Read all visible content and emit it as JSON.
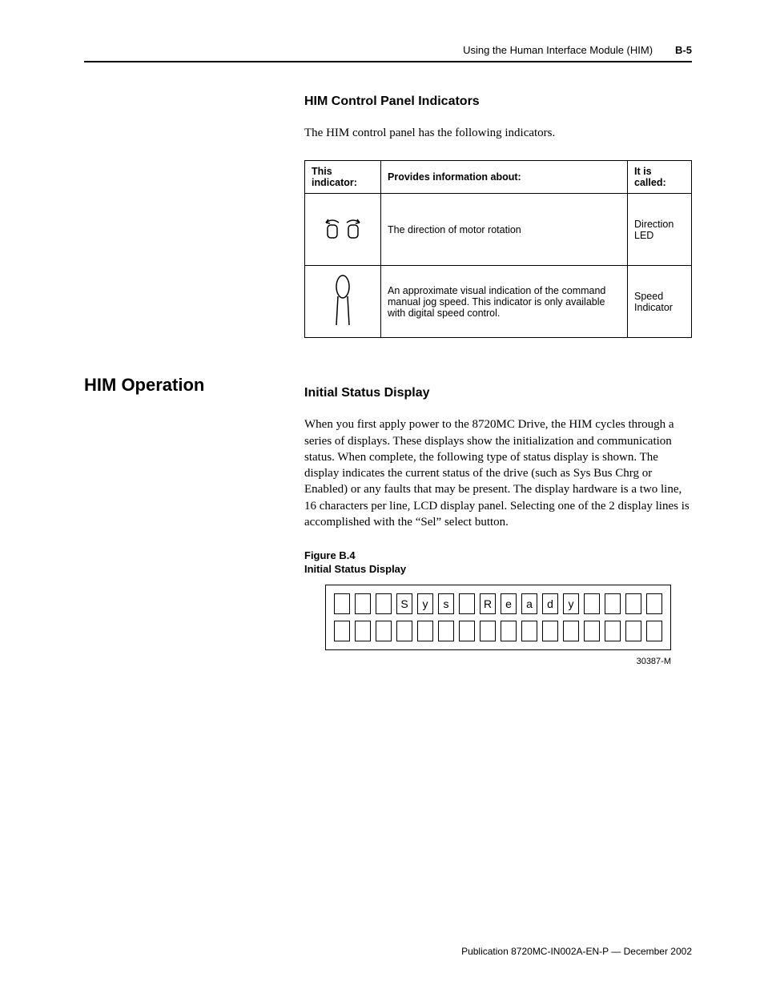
{
  "header": {
    "running_head": "Using the Human Interface Module (HIM)",
    "page_number": "B-5"
  },
  "section1": {
    "heading": "HIM Control Panel Indicators",
    "intro": "The HIM control panel has the following indicators.",
    "table": {
      "headers": [
        "This indicator:",
        "Provides information about:",
        "It is called:"
      ],
      "rows": [
        {
          "provides": "The direction of motor rotation",
          "called": "Direction LED"
        },
        {
          "provides": "An approximate visual indication of the command manual jog speed. This indicator is only available with digital speed control.",
          "called": "Speed Indicator"
        }
      ]
    }
  },
  "sidebar": {
    "heading": "HIM Operation"
  },
  "section2": {
    "heading": "Initial Status Display",
    "body": "When you first apply power to the 8720MC Drive, the HIM cycles through a series of displays. These displays show the initialization and communication status. When complete, the following type of status display is shown. The display indicates the current status of the drive (such as Sys Bus Chrg or Enabled) or any faults that may be present. The display hardware is a two line, 16 characters per line, LCD display panel. Selecting one of the 2 display lines is accomplished with the “Sel” select button.",
    "figure": {
      "label": "Figure B.4",
      "title": "Initial Status Display",
      "line1": [
        "",
        "",
        "",
        "S",
        "y",
        "s",
        "",
        "R",
        "e",
        "a",
        "d",
        "y",
        "",
        "",
        "",
        ""
      ],
      "line2": [
        "",
        "",
        "",
        "",
        "",
        "",
        "",
        "",
        "",
        "",
        "",
        "",
        "",
        "",
        "",
        ""
      ],
      "id": "30387-M"
    }
  },
  "footer": {
    "publication": "Publication 8720MC-IN002A-EN-P — December 2002"
  }
}
